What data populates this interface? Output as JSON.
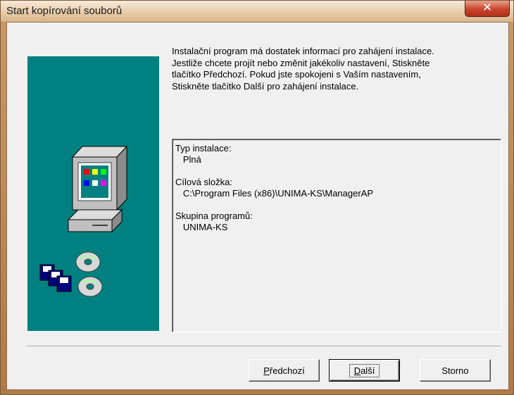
{
  "window": {
    "title": "Start kopírování souborů"
  },
  "description": {
    "lines": [
      "Instalační program má dostatek informací pro zahájení instalace.",
      "Jestliže chcete projít nebo změnit jakékoliv nastavení, Stiskněte",
      "tlačítko Předchozí. Pokud jste spokojeni s Vaším nastavením,",
      "Stiskněte tlačítko Další pro zahájení instalace."
    ]
  },
  "summary": {
    "text": "Typ instalace:\n   Plná\n\nCílová složka:\n   C:\\Program Files (x86)\\UNIMA-KS\\ManagerAP\n\nSkupina programů:\n   UNIMA-KS"
  },
  "buttons": {
    "back": {
      "mnemonic": "P",
      "rest": "ředchozí"
    },
    "next": {
      "mnemonic": "D",
      "rest": "alší"
    },
    "cancel": {
      "label": "Storno"
    }
  },
  "colors": {
    "banner": "#008080",
    "dialog_bg": "#f0f0f0",
    "close_button": "#c8452c"
  },
  "icons": {
    "close": "close-icon",
    "computer": "computer-icon",
    "floppies": "floppy-disks-icon",
    "cds": "cd-disc-icon"
  }
}
